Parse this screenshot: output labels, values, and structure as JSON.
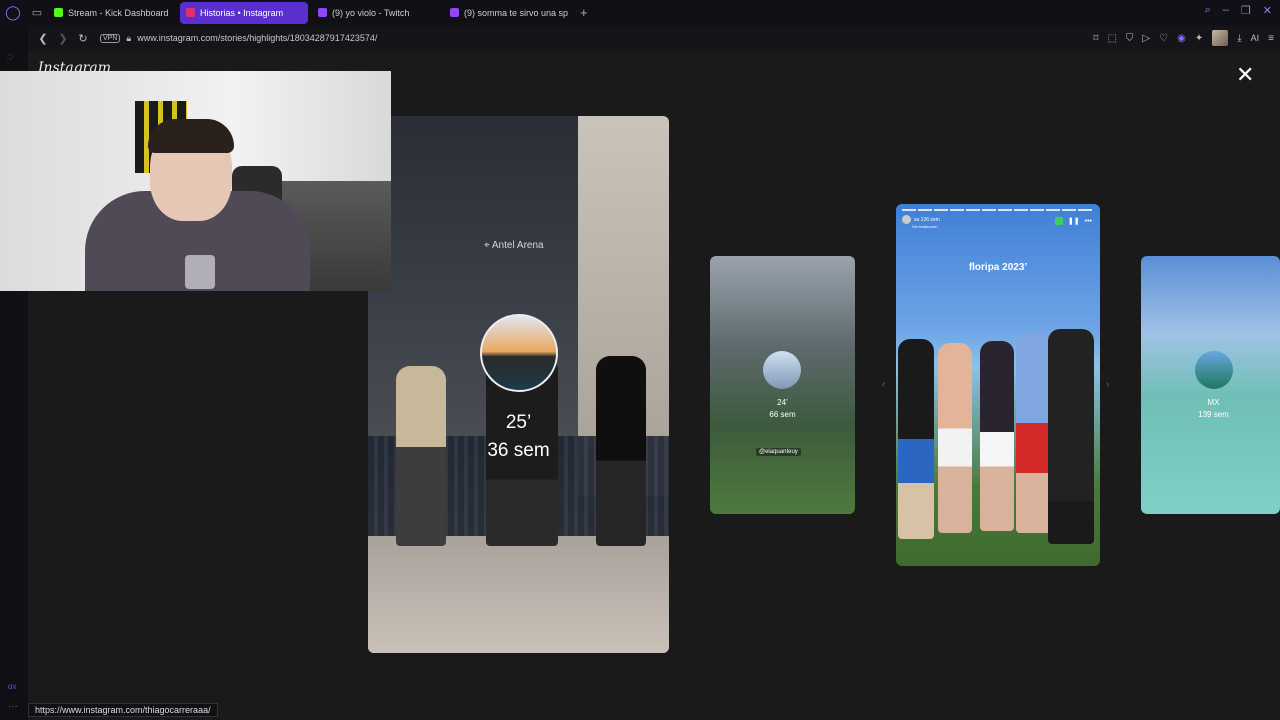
{
  "browser": {
    "tabs": [
      {
        "label": "Stream - Kick Dashboard",
        "color": "#53fc18",
        "active": false
      },
      {
        "label": "Historias • Instagram",
        "color": "#e1306c",
        "active": true
      },
      {
        "label": "(9) yo violo - Twitch",
        "color": "#9146ff",
        "active": false
      },
      {
        "label": "(9) somma te sirvo una sp",
        "color": "#9146ff",
        "active": false
      }
    ],
    "new_tab_label": "+",
    "url": "www.instagram.com/stories/highlights/18034287917423574/",
    "vpn_label": "VPN",
    "ai_label": "AI"
  },
  "instagram": {
    "logo": "Instagram",
    "close": "✕"
  },
  "stories": {
    "main": {
      "location": "Antel Arena",
      "line1": "25’",
      "line2": "36 sem"
    },
    "second": {
      "line1": "24’",
      "line2": "66 sem",
      "mention": "@elaquanteuy"
    },
    "third": {
      "header": "sa  126 sem",
      "subheader": "Ver traducción",
      "caption": "floripa 2023’"
    },
    "fourth": {
      "line1": "MX",
      "line2": "139 sem"
    }
  },
  "statusbar": {
    "link": "https://www.instagram.com/thiagocarreraaa/"
  },
  "sidebar": {
    "bottom_label": "ɑx",
    "dots": "···"
  }
}
